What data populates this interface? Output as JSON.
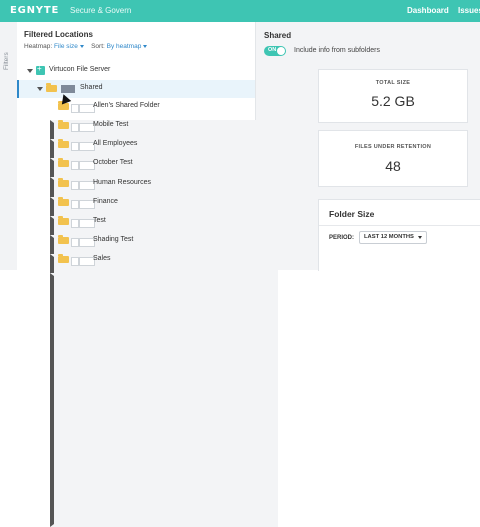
{
  "header": {
    "logo": "EGNYTE",
    "product": "Secure & Govern",
    "nav": [
      "Dashboard",
      "Issues"
    ]
  },
  "rail": {
    "label": "Filters"
  },
  "left_panel": {
    "title": "Filtered Locations",
    "heatmap_label": "Heatmap:",
    "heatmap_value": "File size",
    "sort_label": "Sort:",
    "sort_value": "By heatmap",
    "tree": [
      {
        "label": "Virtucon File Server",
        "level": 0,
        "expanded": true,
        "type": "server"
      },
      {
        "label": "Shared",
        "level": 1,
        "expanded": true,
        "selected": true
      },
      {
        "label": "Allen's Shared Folder",
        "level": 2
      },
      {
        "label": "Mobile Test",
        "level": 2
      },
      {
        "label": "All Employees",
        "level": 2
      },
      {
        "label": "October Test",
        "level": 2
      },
      {
        "label": "Human Resources",
        "level": 2
      },
      {
        "label": "Finance",
        "level": 2
      },
      {
        "label": "Test",
        "level": 2
      },
      {
        "label": "Shading Test",
        "level": 2
      },
      {
        "label": "Sales",
        "level": 2
      }
    ]
  },
  "right_panel": {
    "title": "Shared",
    "toggle_text": "ON",
    "toggle_label": "Include info from subfolders",
    "total_size_label": "TOTAL SIZE",
    "total_size_value": "5.2 GB",
    "retention_label": "FILES UNDER RETENTION",
    "retention_value": "48",
    "folder_size_title": "Folder Size",
    "period_label": "PERIOD:",
    "period_value": "LAST 12 MONTHS"
  },
  "colors": {
    "brand": "#3ec5b3",
    "accent": "#2f88c9",
    "folder": "#f2c24e"
  }
}
